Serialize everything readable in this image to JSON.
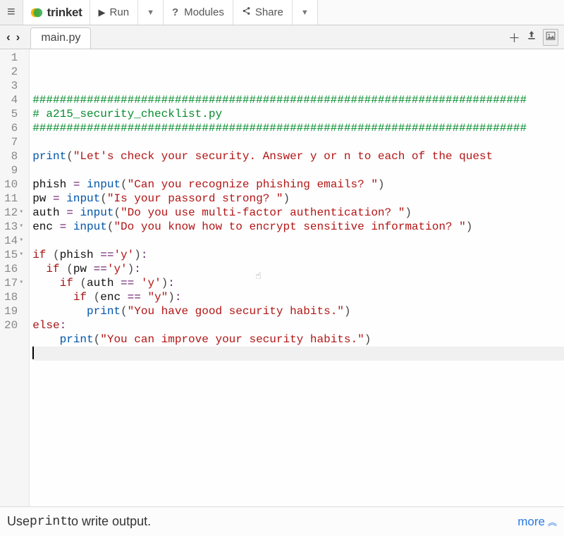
{
  "toolbar": {
    "logo_text": "trinket",
    "run_label": "Run",
    "modules_label": "Modules",
    "share_label": "Share"
  },
  "tabbar": {
    "file_name": "main.py"
  },
  "editor": {
    "line_count": 20,
    "fold_lines": [
      12,
      13,
      14,
      15,
      17
    ],
    "highlighted_line": 19,
    "code_lines": [
      {
        "n": 1,
        "segs": [
          {
            "t": "#########################################################################",
            "c": "comment"
          }
        ]
      },
      {
        "n": 2,
        "segs": [
          {
            "t": "# a215_security_checklist.py",
            "c": "comment"
          }
        ]
      },
      {
        "n": 3,
        "segs": [
          {
            "t": "#########################################################################",
            "c": "comment"
          }
        ]
      },
      {
        "n": 4,
        "segs": []
      },
      {
        "n": 5,
        "segs": [
          {
            "t": "print",
            "c": "builtin"
          },
          {
            "t": "(",
            "c": "paren"
          },
          {
            "t": "\"Let's check your security. Answer y or n to each of the quest",
            "c": "string"
          }
        ]
      },
      {
        "n": 6,
        "segs": []
      },
      {
        "n": 7,
        "segs": [
          {
            "t": "phish ",
            "c": "name"
          },
          {
            "t": "=",
            "c": "op"
          },
          {
            "t": " ",
            "c": "name"
          },
          {
            "t": "input",
            "c": "builtin"
          },
          {
            "t": "(",
            "c": "paren"
          },
          {
            "t": "\"Can you recognize phishing emails? \"",
            "c": "string"
          },
          {
            "t": ")",
            "c": "paren"
          }
        ]
      },
      {
        "n": 8,
        "segs": [
          {
            "t": "pw ",
            "c": "name"
          },
          {
            "t": "=",
            "c": "op"
          },
          {
            "t": " ",
            "c": "name"
          },
          {
            "t": "input",
            "c": "builtin"
          },
          {
            "t": "(",
            "c": "paren"
          },
          {
            "t": "\"Is your passord strong? \"",
            "c": "string"
          },
          {
            "t": ")",
            "c": "paren"
          }
        ]
      },
      {
        "n": 9,
        "segs": [
          {
            "t": "auth ",
            "c": "name"
          },
          {
            "t": "=",
            "c": "op"
          },
          {
            "t": " ",
            "c": "name"
          },
          {
            "t": "input",
            "c": "builtin"
          },
          {
            "t": "(",
            "c": "paren"
          },
          {
            "t": "\"Do you use multi-factor authentication? \"",
            "c": "string"
          },
          {
            "t": ")",
            "c": "paren"
          }
        ]
      },
      {
        "n": 10,
        "segs": [
          {
            "t": "enc ",
            "c": "name"
          },
          {
            "t": "=",
            "c": "op"
          },
          {
            "t": " ",
            "c": "name"
          },
          {
            "t": "input",
            "c": "builtin"
          },
          {
            "t": "(",
            "c": "paren"
          },
          {
            "t": "\"Do you know how to encrypt sensitive information? \"",
            "c": "string"
          },
          {
            "t": ")",
            "c": "paren"
          }
        ]
      },
      {
        "n": 11,
        "segs": []
      },
      {
        "n": 12,
        "segs": [
          {
            "t": "if",
            "c": "keyword"
          },
          {
            "t": " ",
            "c": "name"
          },
          {
            "t": "(",
            "c": "paren"
          },
          {
            "t": "phish ",
            "c": "name"
          },
          {
            "t": "==",
            "c": "op"
          },
          {
            "t": "'y'",
            "c": "string"
          },
          {
            "t": ")",
            "c": "paren"
          },
          {
            "t": ":",
            "c": "punc"
          }
        ]
      },
      {
        "n": 13,
        "segs": [
          {
            "t": "  ",
            "c": "name"
          },
          {
            "t": "if",
            "c": "keyword"
          },
          {
            "t": " ",
            "c": "name"
          },
          {
            "t": "(",
            "c": "paren"
          },
          {
            "t": "pw ",
            "c": "name"
          },
          {
            "t": "==",
            "c": "op"
          },
          {
            "t": "'y'",
            "c": "string"
          },
          {
            "t": ")",
            "c": "paren"
          },
          {
            "t": ":",
            "c": "punc"
          }
        ]
      },
      {
        "n": 14,
        "segs": [
          {
            "t": "    ",
            "c": "name"
          },
          {
            "t": "if",
            "c": "keyword"
          },
          {
            "t": " ",
            "c": "name"
          },
          {
            "t": "(",
            "c": "paren"
          },
          {
            "t": "auth ",
            "c": "name"
          },
          {
            "t": "==",
            "c": "op"
          },
          {
            "t": " ",
            "c": "name"
          },
          {
            "t": "'y'",
            "c": "string"
          },
          {
            "t": ")",
            "c": "paren"
          },
          {
            "t": ":",
            "c": "punc"
          }
        ]
      },
      {
        "n": 15,
        "segs": [
          {
            "t": "      ",
            "c": "name"
          },
          {
            "t": "if",
            "c": "keyword"
          },
          {
            "t": " ",
            "c": "name"
          },
          {
            "t": "(",
            "c": "paren"
          },
          {
            "t": "enc ",
            "c": "name"
          },
          {
            "t": "==",
            "c": "op"
          },
          {
            "t": " ",
            "c": "name"
          },
          {
            "t": "\"y\"",
            "c": "string"
          },
          {
            "t": ")",
            "c": "paren"
          },
          {
            "t": ":",
            "c": "punc"
          }
        ]
      },
      {
        "n": 16,
        "segs": [
          {
            "t": "        ",
            "c": "name"
          },
          {
            "t": "print",
            "c": "builtin"
          },
          {
            "t": "(",
            "c": "paren"
          },
          {
            "t": "\"You have good security habits.\"",
            "c": "string"
          },
          {
            "t": ")",
            "c": "paren"
          }
        ]
      },
      {
        "n": 17,
        "segs": [
          {
            "t": "else",
            "c": "keyword"
          },
          {
            "t": ":",
            "c": "punc"
          }
        ]
      },
      {
        "n": 18,
        "segs": [
          {
            "t": "    ",
            "c": "name"
          },
          {
            "t": "print",
            "c": "builtin"
          },
          {
            "t": "(",
            "c": "paren"
          },
          {
            "t": "\"You can improve your security habits.\"",
            "c": "string"
          },
          {
            "t": ")",
            "c": "paren"
          }
        ]
      },
      {
        "n": 19,
        "segs": []
      },
      {
        "n": 20,
        "segs": []
      }
    ]
  },
  "footer": {
    "hint_prefix": "Use ",
    "hint_code": "print",
    "hint_suffix": " to write output.",
    "more_label": "more"
  }
}
